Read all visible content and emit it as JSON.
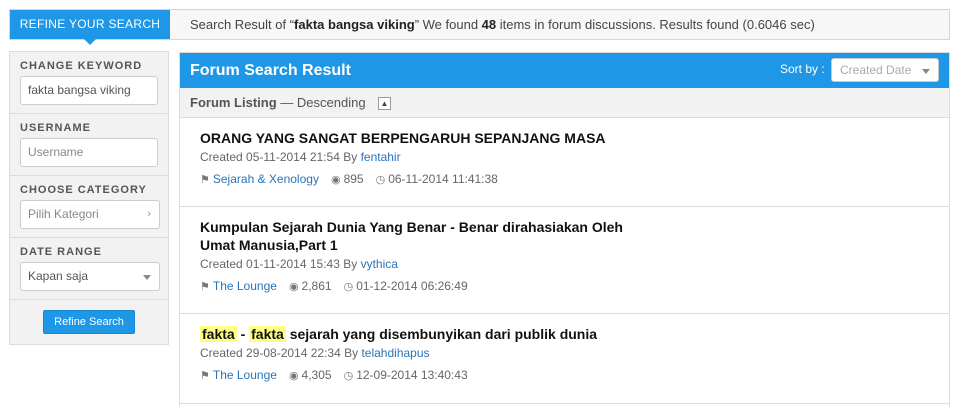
{
  "refine_tab": "REFINE YOUR SEARCH",
  "summary": {
    "prefix": "Search Result of “",
    "query": "fakta bangsa viking",
    "mid": "” We found ",
    "count": "48",
    "suffix": " items in forum discussions. Results found (0.6046 sec)"
  },
  "sidebar": {
    "keyword_label": "CHANGE KEYWORD",
    "keyword_value": "fakta bangsa viking",
    "username_label": "USERNAME",
    "username_placeholder": "Username",
    "category_label": "CHOOSE CATEGORY",
    "category_placeholder": "Pilih Kategori",
    "date_label": "DATE RANGE",
    "date_value": "Kapan saja",
    "refine_button": "Refine Search"
  },
  "main": {
    "title": "Forum Search Result",
    "sort_label": "Sort by :",
    "sort_value": "Created Date",
    "listing_label": "Forum Listing",
    "listing_order": " — Descending"
  },
  "threads": [
    {
      "title": "ORANG YANG SANGAT BERPENGARUH SEPANJANG MASA",
      "created": "Created 05-11-2014 21:54 By ",
      "author": "fentahir",
      "category": "Sejarah & Xenology",
      "views": "895",
      "last": "06-11-2014 11:41:38"
    },
    {
      "title": "Kumpulan Sejarah Dunia Yang Benar - Benar dirahasiakan Oleh Umat Manusia,Part 1",
      "created": "Created 01-11-2014 15:43 By ",
      "author": "vythica",
      "category": "The Lounge",
      "views": "2,861",
      "last": "01-12-2014 06:26:49"
    },
    {
      "title_hl1": "fakta",
      "title_sep": " - ",
      "title_hl2": "fakta",
      "title_rest": " sejarah yang disembunyikan dari publik dunia",
      "created": "Created 29-08-2014 22:34 By ",
      "author": "telahdihapus",
      "category": "The Lounge",
      "views": "4,305",
      "last": "12-09-2014 13:40:43"
    }
  ],
  "icons": [
    "tag-icon",
    "eye-icon",
    "clock-icon",
    "chevron-right-icon",
    "caret-down-icon",
    "collapse-up-icon"
  ],
  "colors": {
    "accent": "#1d97e6",
    "highlight": "#ffff88",
    "link": "#2a74b8"
  }
}
